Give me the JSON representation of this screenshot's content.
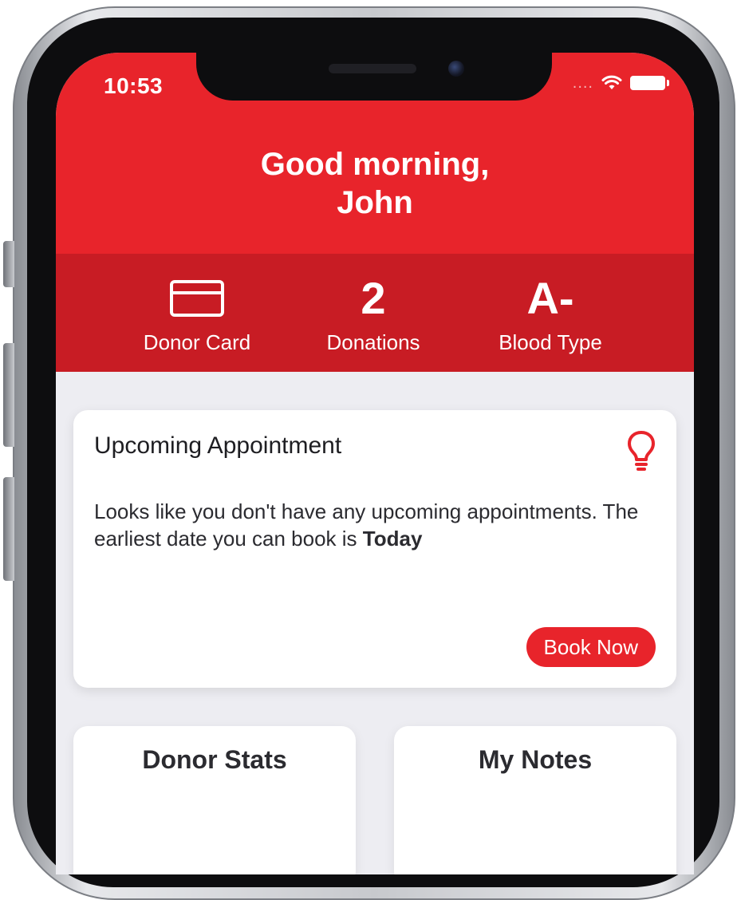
{
  "status_bar": {
    "time": "10:53",
    "signal": "....",
    "wifi_icon": "wifi-icon",
    "battery_icon": "battery-icon"
  },
  "header": {
    "greeting_line1": "Good morning,",
    "greeting_line2": "John",
    "background_color": "#e8242b"
  },
  "stats": {
    "donor_card": {
      "icon": "credit-card-icon",
      "label": "Donor Card"
    },
    "donations": {
      "value": "2",
      "label": "Donations"
    },
    "blood_type": {
      "value": "A-",
      "label": "Blood Type"
    },
    "background_color": "#c81c24"
  },
  "appointment": {
    "title": "Upcoming Appointment",
    "icon": "lightbulb-icon",
    "message": "Looks like you don't have any upcoming appointments. The earliest date you can book is",
    "earliest_date": "Today",
    "button_label": "Book Now"
  },
  "tiles": [
    {
      "title": "Donor Stats"
    },
    {
      "title": "My Notes"
    }
  ],
  "colors": {
    "accent": "#e8242b",
    "content_background": "#ededf2"
  }
}
